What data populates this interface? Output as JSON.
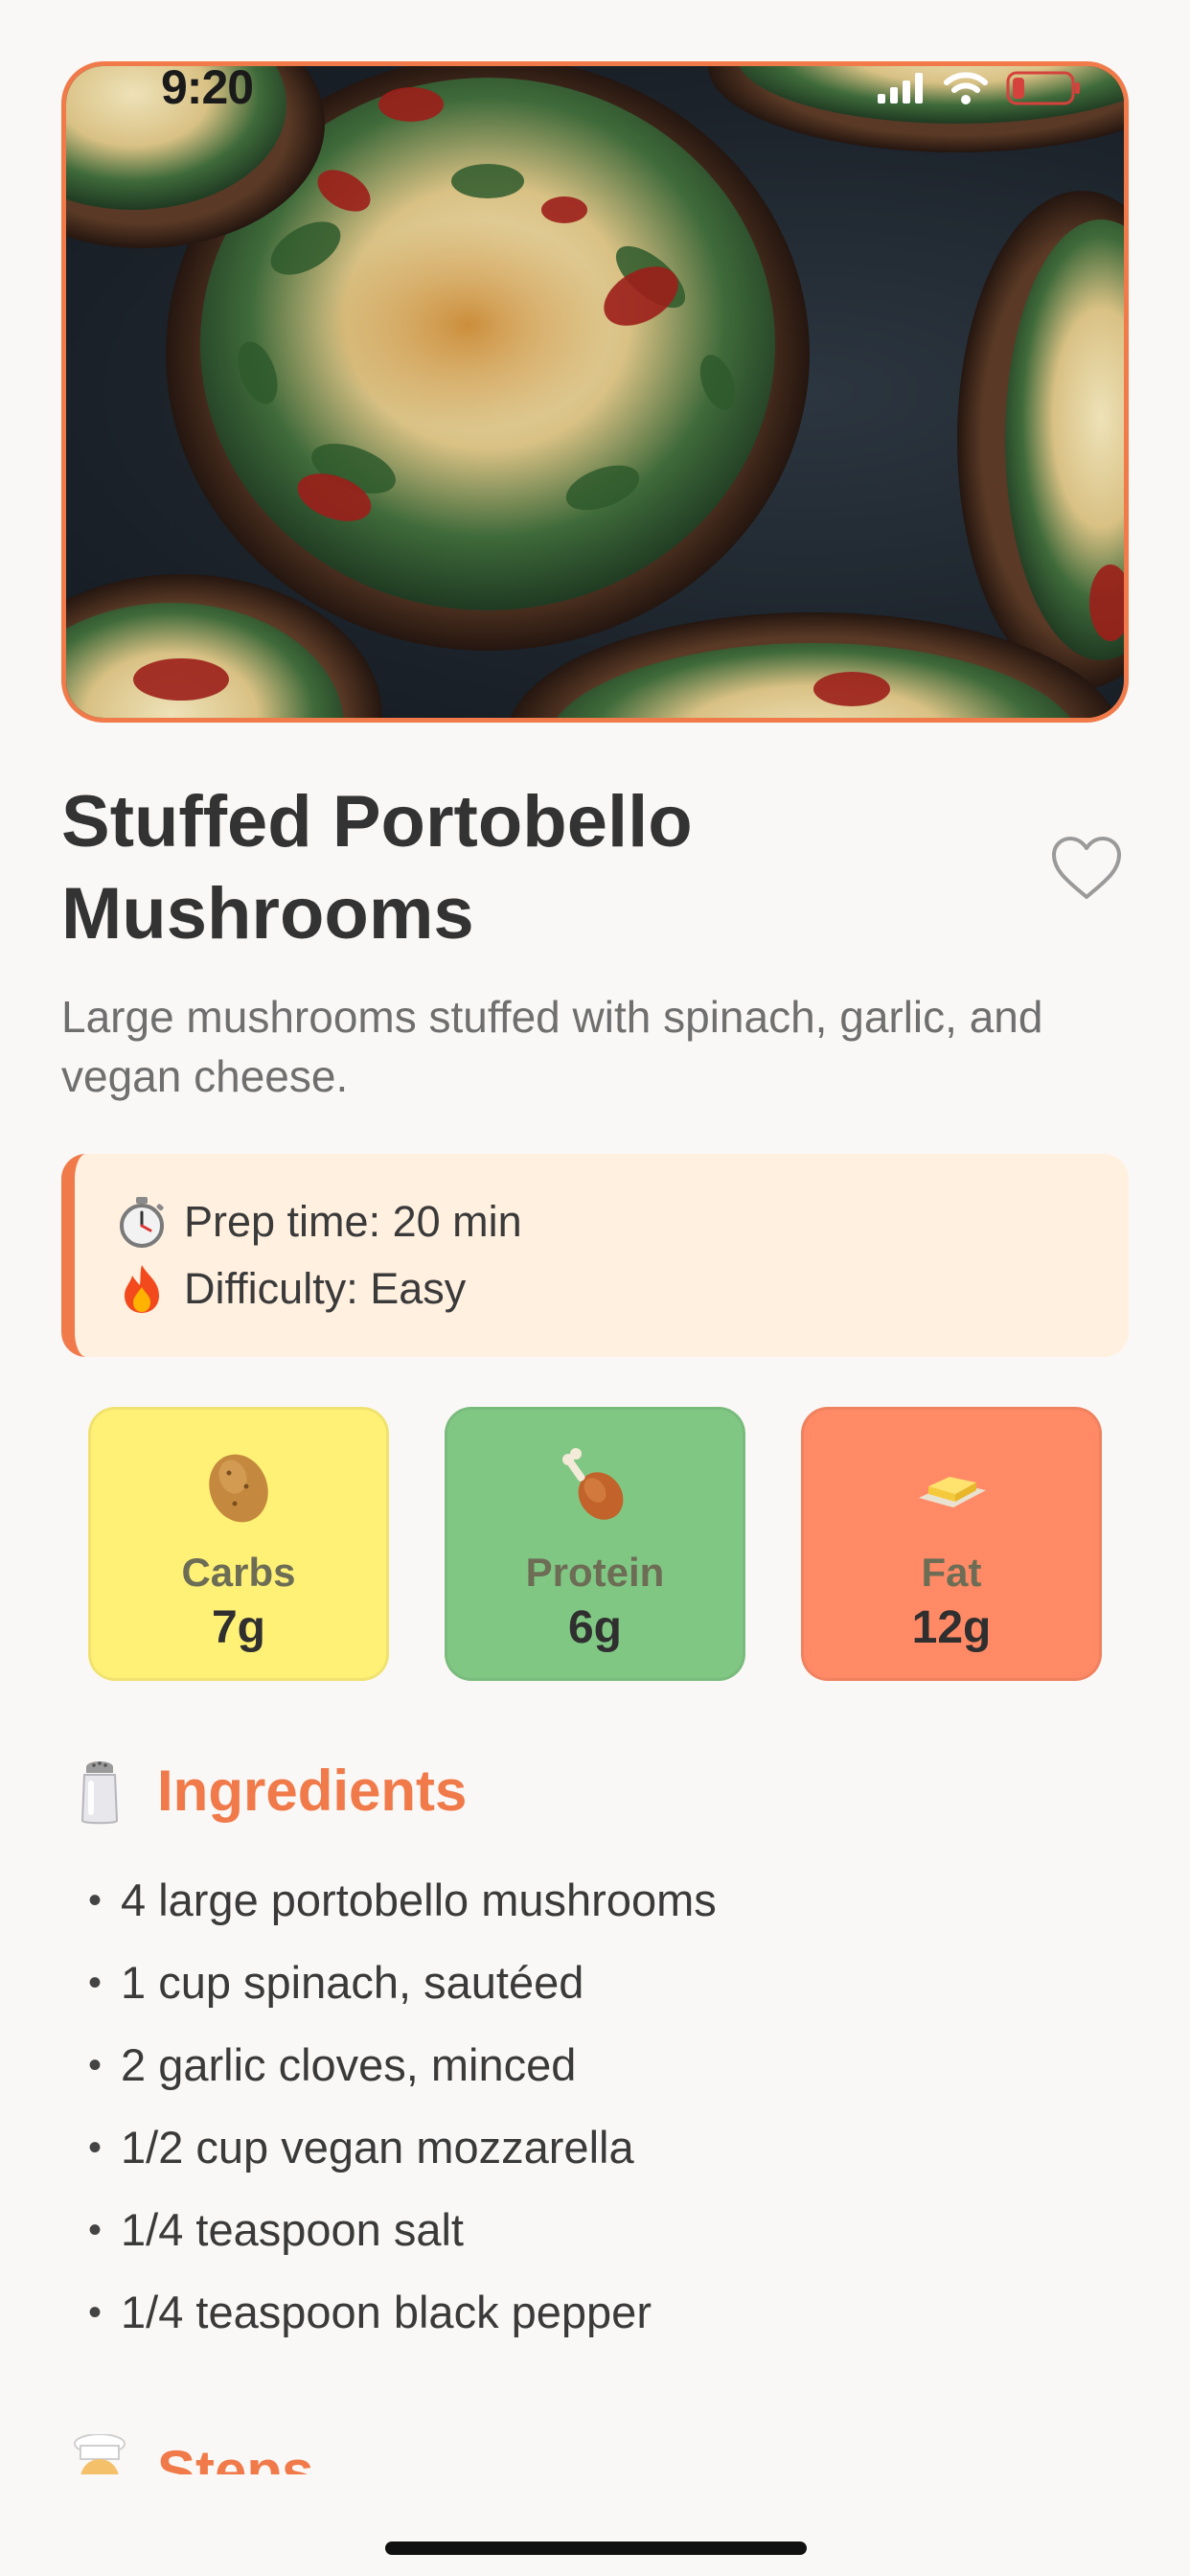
{
  "status_bar": {
    "time": "9:20"
  },
  "recipe": {
    "title_line1": "Stuffed Portobello",
    "title_line2": "Mushrooms",
    "description": "Large mushrooms stuffed with spinach, garlic, and vegan cheese.",
    "favorite_icon": "heart-outline-icon"
  },
  "info": {
    "prep": {
      "icon": "stopwatch-icon",
      "text": "Prep time: 20 min"
    },
    "difficulty": {
      "icon": "fire-icon",
      "text": "Difficulty: Easy"
    }
  },
  "macros": [
    {
      "icon": "potato-icon",
      "label": "Carbs",
      "value": "7g",
      "color": "#fff176"
    },
    {
      "icon": "drumstick-icon",
      "label": "Protein",
      "value": "6g",
      "color": "#81c784"
    },
    {
      "icon": "butter-icon",
      "label": "Fat",
      "value": "12g",
      "color": "#ff8a65"
    }
  ],
  "ingredients": {
    "icon": "salt-shaker-icon",
    "title": "Ingredients",
    "bullet": "•",
    "items": [
      "4 large portobello mushrooms",
      "1 cup spinach, sautéed",
      "2 garlic cloves, minced",
      "1/2 cup vegan mozzarella",
      "1/4 teaspoon salt",
      "1/4 teaspoon black pepper"
    ]
  },
  "steps": {
    "icon": "chef-icon",
    "title": "Steps"
  },
  "colors": {
    "accent": "#f07a4a",
    "background": "#faf8f6",
    "info_background": "#fff0e0"
  }
}
